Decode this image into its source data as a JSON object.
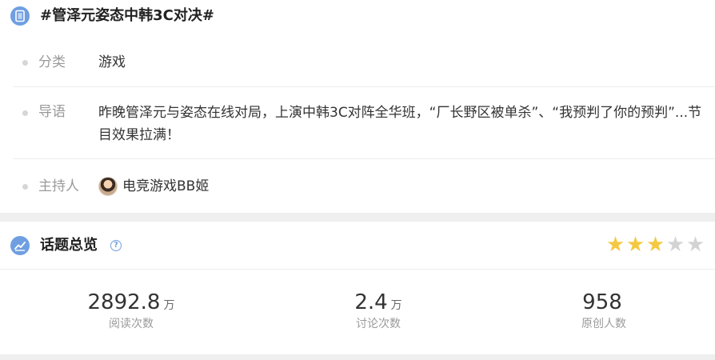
{
  "topic": {
    "title": "#管泽元姿态中韩3C对决#",
    "icon": "list-doc-icon",
    "accent_color": "#6f9fe0"
  },
  "info": {
    "category": {
      "label": "分类",
      "value": "游戏"
    },
    "intro": {
      "label": "导语",
      "value": "昨晚管泽元与姿态在线对局，上演中韩3C对阵全华班，“厂长野区被单杀”、“我预判了你的预判”...节目效果拉满！"
    },
    "host": {
      "label": "主持人",
      "name": "电竞游戏BB姬",
      "avatar": "host-avatar"
    }
  },
  "overview": {
    "title": "话题总览",
    "help_icon": "question-circle-icon",
    "chart_icon": "trend-chart-icon",
    "rating": {
      "value": 3,
      "max": 5,
      "on_color": "#f5c842",
      "off_color": "#d3d3d3"
    },
    "stats": [
      {
        "number": "2892.8",
        "unit": "万",
        "caption": "阅读次数"
      },
      {
        "number": "2.4",
        "unit": "万",
        "caption": "讨论次数"
      },
      {
        "number": "958",
        "unit": "",
        "caption": "原创人数"
      }
    ]
  }
}
